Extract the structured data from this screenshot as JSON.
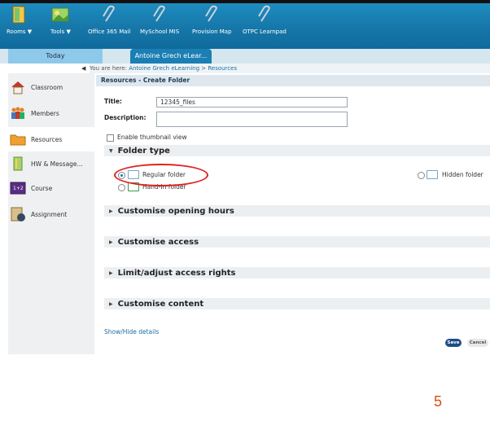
{
  "top_nav": {
    "items": [
      {
        "label": "Rooms ▼",
        "icon": "rooms-icon"
      },
      {
        "label": "Tools ▼",
        "icon": "tools-icon"
      },
      {
        "label": "Office 365 Mail",
        "icon": "paperclip-icon"
      },
      {
        "label": "MySchool MIS",
        "icon": "paperclip-icon"
      },
      {
        "label": "Provision Map",
        "icon": "paperclip-icon"
      },
      {
        "label": "OTPC Learnpad",
        "icon": "paperclip-icon"
      }
    ]
  },
  "tabs": {
    "today": "Today",
    "active": "Antoine Grech eLear..."
  },
  "breadcrumb": {
    "prefix": "You are here:",
    "link": "Antoine Grech eLearning",
    "separator": ">",
    "current": "Resources"
  },
  "sidebar": {
    "items": [
      {
        "label": "Classroom",
        "icon": "house-icon"
      },
      {
        "label": "Members",
        "icon": "people-icon"
      },
      {
        "label": "Resources",
        "icon": "folder-icon",
        "active": true
      },
      {
        "label": "HW & Message...",
        "icon": "book-icon"
      },
      {
        "label": "Course",
        "icon": "course-icon"
      },
      {
        "label": "Assignment",
        "icon": "assignment-icon"
      }
    ]
  },
  "form": {
    "page_title": "Resources - Create Folder",
    "title_label": "Title:",
    "title_value": "12345_files",
    "description_label": "Description:",
    "description_value": "",
    "thumbnail_label": "Enable thumbnail view",
    "thumbnail_checked": false
  },
  "folder_type": {
    "heading": "Folder type",
    "regular": "Regular folder",
    "handin": "Hand-In folder",
    "hidden": "Hidden folder",
    "selected": "regular"
  },
  "sections": {
    "opening_hours": "Customise opening hours",
    "access": "Customise access",
    "access_rights": "Limit/adjust access rights",
    "content": "Customise content"
  },
  "footer": {
    "show_hide": "Show/Hide details",
    "save": "Save",
    "cancel": "Cancel"
  },
  "page_number": "5",
  "colors": {
    "top_bar": "#1676a8",
    "annotation": "#e02020",
    "page_number": "#e04a12",
    "save_button": "#1d4e86"
  }
}
